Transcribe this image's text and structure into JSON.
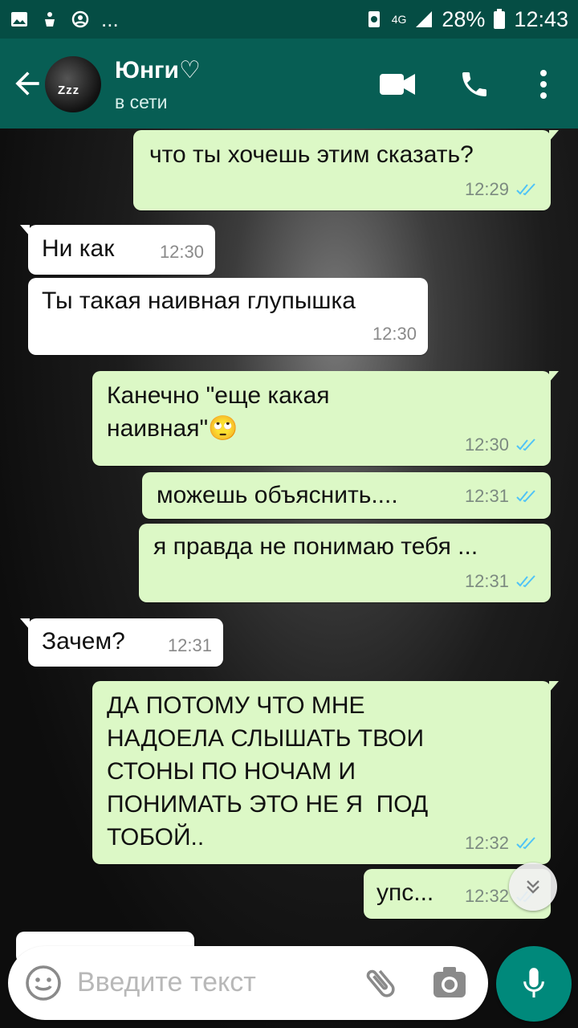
{
  "status_bar": {
    "battery": "28%",
    "time": "12:43",
    "network": "4G",
    "left_icons": [
      "image-icon",
      "download-icon",
      "settings-icon"
    ],
    "more": "..."
  },
  "header": {
    "contact_name": "Юнги♡",
    "contact_status": "в сети",
    "avatar_text": "Zzz"
  },
  "messages": [
    {
      "dir": "out",
      "text": "что ты хочешь этим сказать?",
      "time": "12:29",
      "read": true
    },
    {
      "dir": "in",
      "text": "Ни как",
      "time": "12:30"
    },
    {
      "dir": "in",
      "text": "Ты такая наивная глупышка",
      "time": "12:30"
    },
    {
      "dir": "out",
      "text": "Канечно \"еще какая наивная\"🙄",
      "time": "12:30",
      "read": true
    },
    {
      "dir": "out",
      "text": "можешь объяснить....",
      "time": "12:31",
      "read": true
    },
    {
      "dir": "out",
      "text": "я правда не понимаю тебя ...",
      "time": "12:31",
      "read": true
    },
    {
      "dir": "in",
      "text": "Зачем?",
      "time": "12:31"
    },
    {
      "dir": "out",
      "text": "ДА ПОТОМУ ЧТО МНЕ НАДОЕЛА СЛЫШАТЬ ТВОИ СТОНЫ ПО НОЧАМ И ПОНИМАТЬ ЭТО НЕ Я  ПОД ТОБОЙ..",
      "time": "12:32",
      "read": true
    },
    {
      "dir": "out",
      "text": "упс...",
      "time": "12:32",
      "read": true
    }
  ],
  "input": {
    "placeholder": "Введите текст"
  },
  "colors": {
    "header": "#075e54",
    "status_bar": "#054d44",
    "outgoing_bubble": "#dcf8c6",
    "incoming_bubble": "#ffffff",
    "read_tick": "#4fc3f7",
    "mic_button": "#00897b"
  }
}
